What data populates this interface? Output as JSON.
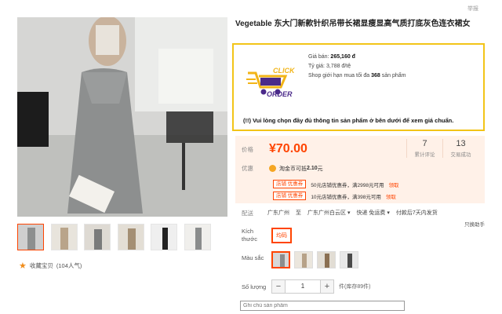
{
  "header": {
    "report": "举报"
  },
  "product": {
    "title": "Vegetable 东大门新款针织吊带长裙显瘦显高气质打底灰色连衣裙女"
  },
  "order_box": {
    "logo_line1": "CLICK",
    "logo_line2": "ORDER",
    "price_vnd_label": "Giá bán:",
    "price_vnd": "265,160 đ",
    "rate_label": "Tỷ giá:",
    "rate": "3,788 đ/tệ",
    "limit_pre": "Shop giới hạn mua tối đa",
    "limit_num": "368",
    "limit_post": "sản phẩm",
    "notice": "(!!) Vui lòng chọn đầy đủ thông tin sản phẩm ở bên dưới để xem giá chuẩn."
  },
  "price_box": {
    "price_label": "价格",
    "price": "¥70.00",
    "reviews_count": "7",
    "reviews_label": "累计评论",
    "sales_count": "13",
    "sales_label": "交易成功",
    "promo_label": "优惠",
    "coin_text_pre": "淘金币可抵",
    "coin_amount": "2.10",
    "coin_text_post": "元",
    "coupons": [
      {
        "tag": "店铺  优惠券",
        "text": "50元店铺优惠券，满2998元可用",
        "action": "领取"
      },
      {
        "tag": "店铺  优惠券",
        "text": "10元店铺优惠券，满398元可用",
        "action": "领取"
      }
    ]
  },
  "shipping": {
    "label": "配送",
    "from": "广东广州",
    "to_word": "至",
    "to": "广东广州白云区",
    "method": "快递 免运费",
    "time": "付款后7天内发货",
    "insurance": "只换助手"
  },
  "size": {
    "label_line1": "Kích",
    "label_line2": "thước",
    "option": "均码"
  },
  "color": {
    "label": "Màu sắc"
  },
  "quantity": {
    "label": "Số lượng",
    "value": "1",
    "minus": "−",
    "plus": "+",
    "stock": "件(库存89件)"
  },
  "note": {
    "placeholder": "Ghi chú sản phẩm"
  },
  "gallery": {
    "favorite_label": "收藏宝贝",
    "favorite_count": "(104人气)"
  },
  "colors": {
    "accent": "#ff4400",
    "price_bg": "#fff1e8",
    "promo_border": "#f2c418",
    "logo_yellow": "#f2b417",
    "logo_purple": "#4b2a8a"
  },
  "icons": [
    "star-icon",
    "coin-icon",
    "cart-logo-icon",
    "dropdown-caret-icon"
  ]
}
